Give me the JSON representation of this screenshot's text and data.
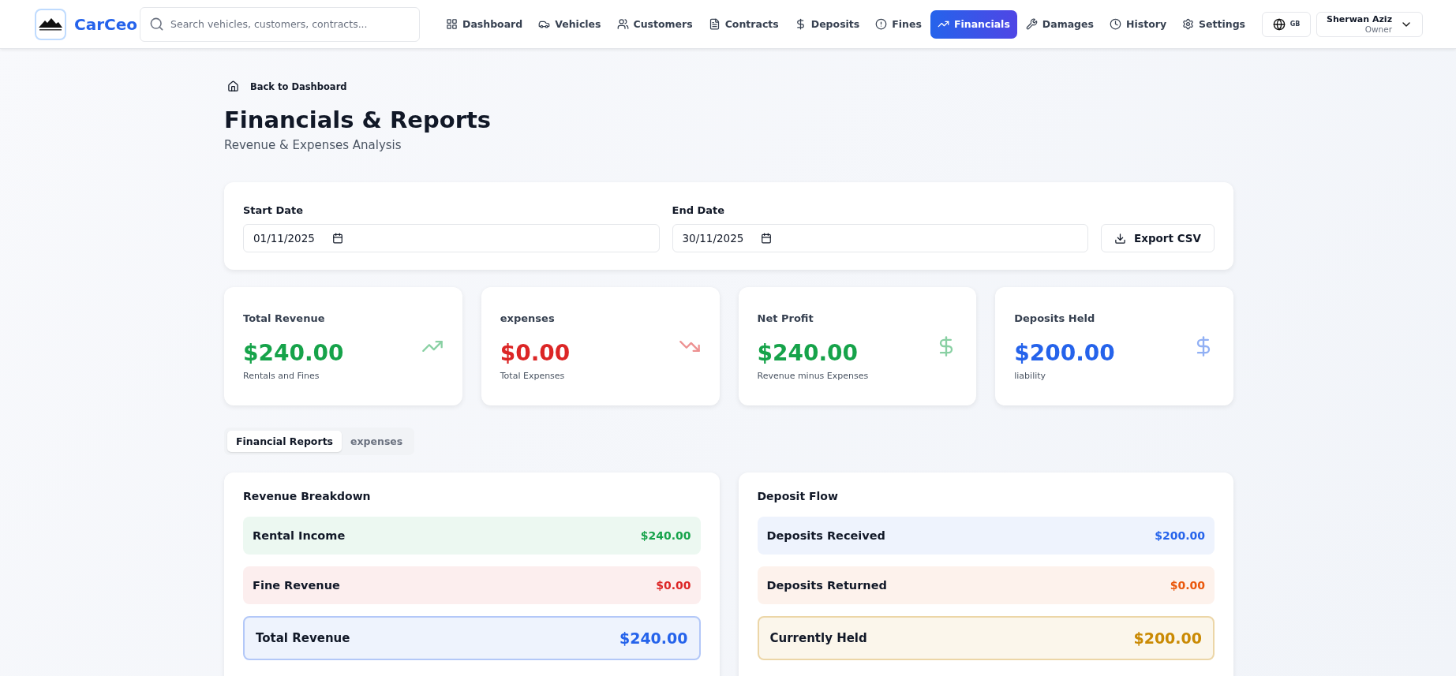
{
  "brand": {
    "name": "CarCeo"
  },
  "search": {
    "placeholder": "Search vehicles, customers, contracts..."
  },
  "nav": [
    {
      "label": "Dashboard",
      "selected": false
    },
    {
      "label": "Vehicles",
      "selected": false
    },
    {
      "label": "Customers",
      "selected": false
    },
    {
      "label": "Contracts",
      "selected": false
    },
    {
      "label": "Deposits",
      "selected": false
    },
    {
      "label": "Fines",
      "selected": false
    },
    {
      "label": "Financials",
      "selected": true
    },
    {
      "label": "Damages",
      "selected": false
    },
    {
      "label": "History",
      "selected": false
    },
    {
      "label": "Settings",
      "selected": false
    }
  ],
  "language": {
    "code": "GB"
  },
  "user": {
    "name": "Sherwan Aziz",
    "role": "Owner"
  },
  "back_link": "Back to Dashboard",
  "title": "Financials & Reports",
  "subtitle": "Revenue & Expenses Analysis",
  "filters": {
    "start": {
      "label": "Start Date",
      "value": "01/11/2025"
    },
    "end": {
      "label": "End Date",
      "value": "30/11/2025"
    },
    "export": "Export CSV"
  },
  "stats": [
    {
      "label": "Total Revenue",
      "value": "$240.00",
      "note": "Rentals and Fines",
      "kind": "rising",
      "color": "#16a34a"
    },
    {
      "label": "expenses",
      "value": "$0.00",
      "note": "Total Expenses",
      "kind": "falling",
      "color": "#dc2626"
    },
    {
      "label": "Net Profit",
      "value": "$240.00",
      "note": "Revenue minus Expenses",
      "kind": "money",
      "color": "#16a34a"
    },
    {
      "label": "Deposits Held",
      "value": "$200.00",
      "note": "liability",
      "kind": "money",
      "color": "#2563eb"
    }
  ],
  "tabs": [
    {
      "label": "Financial Reports",
      "selected": true
    },
    {
      "label": "expenses",
      "selected": false
    }
  ],
  "panels": [
    {
      "title": "Revenue Breakdown",
      "rows": [
        {
          "label": "Rental Income",
          "amount": "$240.00",
          "kind": "line",
          "color": "#16a34a"
        },
        {
          "label": "Fine Revenue",
          "amount": "$0.00",
          "kind": "line",
          "color": "#dc2626"
        },
        {
          "label": "Total Revenue",
          "amount": "$240.00",
          "kind": "total",
          "color": "#2563eb"
        }
      ]
    },
    {
      "title": "Deposit Flow",
      "rows": [
        {
          "label": "Deposits Received",
          "amount": "$200.00",
          "kind": "line",
          "color": "#2563eb"
        },
        {
          "label": "Deposits Returned",
          "amount": "$0.00",
          "kind": "line",
          "color": "#ea580c"
        },
        {
          "label": "Currently Held",
          "amount": "$200.00",
          "kind": "total",
          "color": "#ca8a04"
        }
      ]
    }
  ]
}
